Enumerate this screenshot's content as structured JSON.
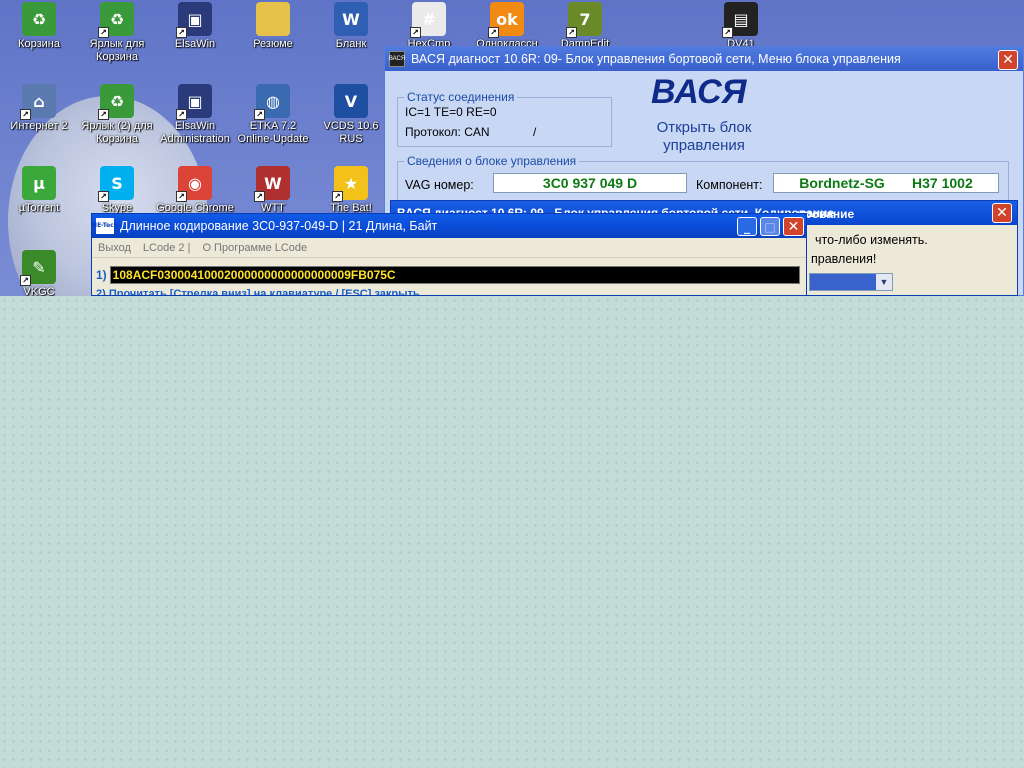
{
  "desktop": {
    "icons": [
      {
        "label": "Корзина",
        "icon": "recycle-bin-icon",
        "color": "#3a9a3a"
      },
      {
        "label": "Ярлык для Корзина",
        "icon": "recycle-bin-shortcut-icon",
        "color": "#3a9a3a"
      },
      {
        "label": "ElsaWin",
        "icon": "computer-icon",
        "color": "#2a3a7a"
      },
      {
        "label": "Резюме",
        "icon": "folder-icon",
        "color": "#e7c24a"
      },
      {
        "label": "Бланк",
        "icon": "word-document-icon",
        "color": "#2f5fb3"
      },
      {
        "label": "HexCmp",
        "icon": "hexcmp-icon",
        "color": "#eaeaea"
      },
      {
        "label": "Одноклассн",
        "icon": "odnoklassniki-icon",
        "color": "#f08a12"
      },
      {
        "label": "DampEdit",
        "icon": "dampedit-icon",
        "color": "#6a8a2a"
      },
      {
        "label": "DV41",
        "icon": "chip-icon",
        "color": "#222222"
      },
      {
        "label": "Интернет 2",
        "icon": "network-icon",
        "color": "#5a7ab0"
      },
      {
        "label": "Ярлык (2) для Корзина",
        "icon": "recycle-bin-shortcut-icon",
        "color": "#3a9a3a"
      },
      {
        "label": "ElsaWin Administration",
        "icon": "computer-icon",
        "color": "#2a3a7a"
      },
      {
        "label": "ETKA 7.2 Online-Update",
        "icon": "globe-icon",
        "color": "#3a6ab0"
      },
      {
        "label": "VCDS 10.6 RUS",
        "icon": "vcds-icon",
        "color": "#1f4fa0"
      },
      {
        "label": "µTorrent",
        "icon": "utorrent-icon",
        "color": "#3aa83a"
      },
      {
        "label": "Skype",
        "icon": "skype-icon",
        "color": "#00aff0"
      },
      {
        "label": "Google Chrome",
        "icon": "chrome-icon",
        "color": "#db4437"
      },
      {
        "label": "WTT",
        "icon": "wtt-icon",
        "color": "#b03030"
      },
      {
        "label": "The Bat!",
        "icon": "the-bat-icon",
        "color": "#f2c21a"
      },
      {
        "label": "VKGC",
        "icon": "vkgc-icon",
        "color": "#3a8a2a"
      }
    ]
  },
  "vasya": {
    "title": "ВАСЯ диагност 10.6R: 09- Блок управления бортовой сети,  Меню блока управления",
    "close": "✕",
    "status_title": "Статус соединения",
    "status_line": "IC=1  TE=0   RE=0",
    "protocol_label": "Протокол: CAN",
    "protocol_sep": "/",
    "brand": "ВАСЯ",
    "open_block": "Открыть блок управления",
    "info_title": "Сведения о блоке управления",
    "vag_label": "VAG номер:",
    "vag_value": "3C0 937 049 D",
    "component_label": "Компонент:",
    "component_value": "Bordnetz-SG       H37 1002"
  },
  "popup": {
    "title_left": "ВАСЯ диагност 10.6R: 09 - Блок управления бортовой сети, Кодирование",
    "title_right": "ирование",
    "close": "✕",
    "line1": "что-либо изменять.",
    "line2": "правления!"
  },
  "lcode": {
    "title": "Длинное кодирование  3C0-937-049-D | 21 Длина, Байт",
    "logo": "NE-Tech",
    "minimize": "_",
    "maximize": "□",
    "close": "✕",
    "menu": [
      "Выход",
      "LCode 2 |",
      "О Программе LCode"
    ],
    "row_num": "1)",
    "code": "108ACF03000410002000000000000000009FB075C",
    "hint": "2) Прочитать [Стрелка вниз] на клавиатуре / [ESC] закрыть"
  }
}
